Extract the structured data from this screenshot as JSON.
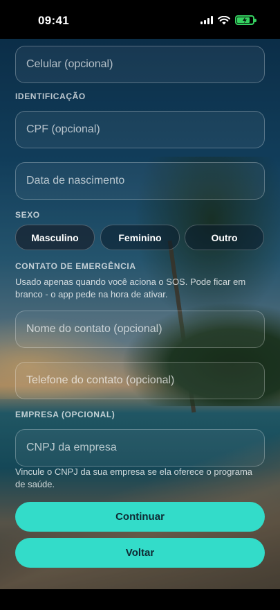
{
  "status_bar": {
    "time": "09:41"
  },
  "form": {
    "mobile": {
      "placeholder": "Celular (opcional)",
      "value": ""
    },
    "identification_label": "IDENTIFICAÇÃO",
    "cpf": {
      "placeholder": "CPF (opcional)",
      "value": ""
    },
    "birthdate": {
      "placeholder": "Data de nascimento",
      "value": ""
    },
    "sex_label": "SEXO",
    "sex_options": [
      "Masculino",
      "Feminino",
      "Outro"
    ],
    "sex_selected": "Masculino",
    "emergency_label": "CONTATO DE EMERGÊNCIA",
    "emergency_help": "Usado apenas quando você aciona o SOS. Pode ficar em branco - o app pede na hora de ativar.",
    "contact_name": {
      "placeholder": "Nome do contato (opcional)",
      "value": ""
    },
    "contact_phone": {
      "placeholder": "Telefone do contato (opcional)",
      "value": ""
    },
    "company_label": "EMPRESA (OPCIONAL)",
    "cnpj": {
      "placeholder": "CNPJ da empresa",
      "value": ""
    },
    "company_help": "Vincule o CNPJ da sua empresa se ela oferece o programa de saúde."
  },
  "actions": {
    "continue_label": "Continuar",
    "back_label": "Voltar"
  },
  "colors": {
    "accent": "#33dcc9",
    "battery": "#35d160"
  }
}
